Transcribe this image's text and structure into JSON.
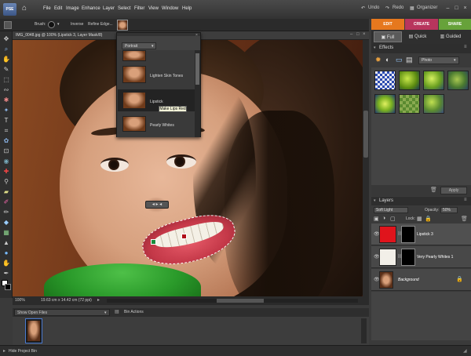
{
  "app": {
    "logo_text": "PSE"
  },
  "menu": [
    "File",
    "Edit",
    "Image",
    "Enhance",
    "Layer",
    "Select",
    "Filter",
    "View",
    "Window",
    "Help"
  ],
  "topbar": {
    "undo": "Undo",
    "redo": "Redo",
    "organizer": "Organizer"
  },
  "options": {
    "brush_label": "Brush:",
    "inverse": "Inverse",
    "refine_edge": "Refine Edge..."
  },
  "tabs": {
    "edit": "EDIT",
    "create": "CREATE",
    "share": "SHARE"
  },
  "modes": {
    "full": "Full",
    "quick": "Quick",
    "guided": "Guided"
  },
  "document": {
    "title": "IMG_0048.jpg @ 100% (Lipstick 3, Layer Mask/8)",
    "zoom": "100%",
    "info": "19.63 cm x 14.42 cm (72 ppi)"
  },
  "presets": {
    "category": "Portrait",
    "items": [
      {
        "label": ""
      },
      {
        "label": "Lighten Skin Tones"
      },
      {
        "label": "Lipstick"
      },
      {
        "label": "Pearly Whites"
      }
    ],
    "tooltip": "Make Lips Red"
  },
  "effects": {
    "title": "Effects",
    "filter": "Photo",
    "apply": "Apply"
  },
  "layers": {
    "title": "Layers",
    "blend_mode": "Soft Light",
    "opacity_label": "Opacity:",
    "opacity": "50%",
    "lock_label": "Lock:",
    "items": [
      {
        "name": "Lipstick 3",
        "color": "#e0141c"
      },
      {
        "name": "Very Pearly Whites 1",
        "color": "#f2efe8"
      },
      {
        "name": "Background",
        "color": "#7a4a30"
      }
    ]
  },
  "bin": {
    "show": "Show Open Files",
    "actions": "Bin Actions"
  },
  "bottom": {
    "hide_bin": "Hide Project Bin"
  }
}
